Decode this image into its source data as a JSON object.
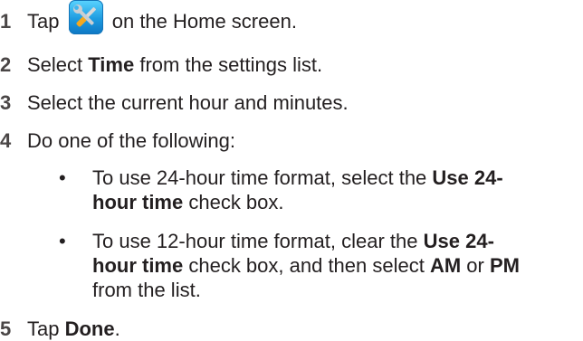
{
  "steps": [
    {
      "number": "1",
      "before": "Tap",
      "after": "on the Home screen.",
      "icon": "settings-tools-icon"
    },
    {
      "number": "2",
      "before": "Select ",
      "bold": "Time",
      "after": " from the settings list."
    },
    {
      "number": "3",
      "text": "Select the current hour and minutes."
    },
    {
      "number": "4",
      "text": "Do one of the following:"
    },
    {
      "number": "5",
      "before": "Tap ",
      "bold": "Done",
      "after": "."
    }
  ],
  "bullets": [
    {
      "marker": "•",
      "line1_before": "To use 24-hour time format, select the ",
      "line1_bold": "Use 24-",
      "line2_bold": "hour time",
      "line2_after": " check box."
    },
    {
      "marker": "•",
      "line1_before": "To use 12-hour time format, clear the ",
      "line1_bold": "Use 24-",
      "line2_bold": "hour time",
      "line2_mid": " check box, and then select ",
      "line2_bold2": "AM",
      "line2_mid2": " or ",
      "line2_bold3": "PM",
      "line3": "from the list."
    }
  ],
  "colors": {
    "text": "#231f20",
    "icon_blue": "#1e9be0"
  }
}
